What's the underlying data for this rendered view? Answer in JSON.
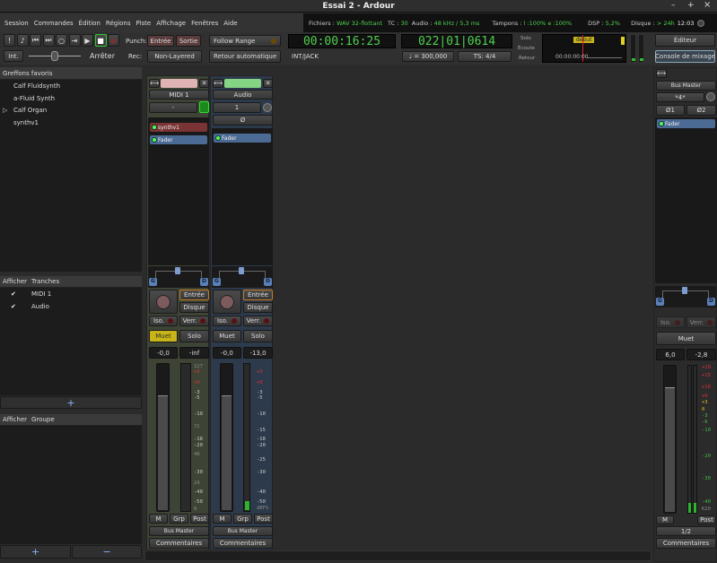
{
  "window": {
    "title": "Essai 2 - Ardour",
    "min": "–",
    "max": "+",
    "close": "×"
  },
  "menu": [
    "Session",
    "Commandes",
    "Édition",
    "Régions",
    "Piste",
    "Affichage",
    "Fenêtres",
    "Aide"
  ],
  "status": {
    "files_label": "Fichiers :",
    "files_value": "WAV 32-flottant",
    "tc_label": "TC :",
    "tc_value": "30",
    "audio_label": "Audio :",
    "audio_value": "48 kHz / 5,3 ms",
    "buffers_label": "Tampons :",
    "buffers_value": "l :100% e :100%",
    "dsp_label": "DSP :",
    "dsp_value": "5,2%",
    "disk_label": "Disque :",
    "disk_value": "> 24h",
    "time": "12:03"
  },
  "toolbar": {
    "punch_label": "Punch:",
    "punch_in": "Entrée",
    "punch_out": "Sortie",
    "follow_range": "Follow Range",
    "retour_auto": "Retour automatique",
    "int": "Int.",
    "shuttle_state": "Arrêter",
    "rec_label": "Rec:",
    "rec_mode": "Non-Layered",
    "primary_clock": "00:00:16:25",
    "sync": "INT/JACK",
    "secondary_clock": "022|01|0614",
    "tempo": "♩ = 300,000",
    "meter": "TS: 4/4",
    "solo": "Solo",
    "ecoute": "Écoute",
    "retour": "Retour",
    "marker": "début",
    "mini_time": "00:00:00:00",
    "editor": "Éditeur",
    "mixer": "Console de mixage"
  },
  "sidebar": {
    "favorites_header": "Greffons favoris",
    "favorites": [
      "Calf Fluidsynth",
      "a-Fluid Synth",
      "Calf Organ",
      "synthv1"
    ],
    "strips_show": "Afficher",
    "strips_header": "Tranches",
    "strips": [
      {
        "name": "MIDI 1",
        "shown": true
      },
      {
        "name": "Audio",
        "shown": true
      }
    ],
    "groups_show": "Afficher",
    "groups_header": "Groupe",
    "add": "+",
    "remove": "−",
    "check": "✔"
  },
  "strips": [
    {
      "name": "MIDI 1",
      "color": "#e0b4b4",
      "bg": "#3d4436",
      "input": "-",
      "plugins": [
        "synthv1",
        "Fader"
      ],
      "in_btn": "Entrée",
      "disk_btn": "Disque",
      "iso": "Iso.",
      "lock": "Verr.",
      "mute": "Muet",
      "solo": "Solo",
      "muted": true,
      "gain": "-0,0",
      "peak": "-inf",
      "meter_fill": 0,
      "fader_level": 0.78,
      "scale": [
        "127",
        "+3",
        "+0",
        "-3",
        "-5",
        "-10",
        "72",
        "-18",
        "-20",
        "48",
        "-30",
        "24",
        "-40",
        "-50",
        "0"
      ],
      "m": "M",
      "grp": "Grp",
      "post": "Post",
      "output": "Bus Master",
      "comments": "Commentaires",
      "pan_l": "G",
      "pan_r": "D"
    },
    {
      "name": "Audio",
      "color": "#84d484",
      "bg": "#2d3a4b",
      "input": "1",
      "phase": "Ø",
      "plugins": [
        "Fader"
      ],
      "in_btn": "Entrée",
      "disk_btn": "Disque",
      "iso": "Iso.",
      "lock": "Verr.",
      "mute": "Muet",
      "solo": "Solo",
      "muted": false,
      "gain": "-0,0",
      "peak": "-13,0",
      "meter_fill": 0.06,
      "fader_level": 0.78,
      "scale": [
        "+3",
        "+0",
        "-3",
        "-5",
        "-10",
        "-15",
        "-18",
        "-20",
        "-25",
        "-30",
        "-40",
        "-50",
        "dBFS"
      ],
      "m": "M",
      "grp": "Grp",
      "post": "Post",
      "output": "Bus Master",
      "comments": "Commentaires",
      "pan_l": "G",
      "pan_r": "D"
    }
  ],
  "master": {
    "name": "Bus Master",
    "input": "*4*",
    "phase1": "Ø1",
    "phase2": "Ø2",
    "plugins": [
      "Fader"
    ],
    "iso": "Iso.",
    "lock": "Verr.",
    "mute": "Muet",
    "gain": "6,0",
    "peak": "-2,8",
    "fader_level": 0.85,
    "meter_fill": 0.07,
    "scale": [
      "+20",
      "+15",
      "+10",
      "+6",
      "+3",
      "0",
      "-3",
      "-6",
      "-10",
      "-20",
      "-30",
      "-40",
      "K20"
    ],
    "m": "M",
    "post": "Post",
    "output": "1/2",
    "comments": "Commentaires",
    "pan_l": "G",
    "pan_r": "D"
  }
}
